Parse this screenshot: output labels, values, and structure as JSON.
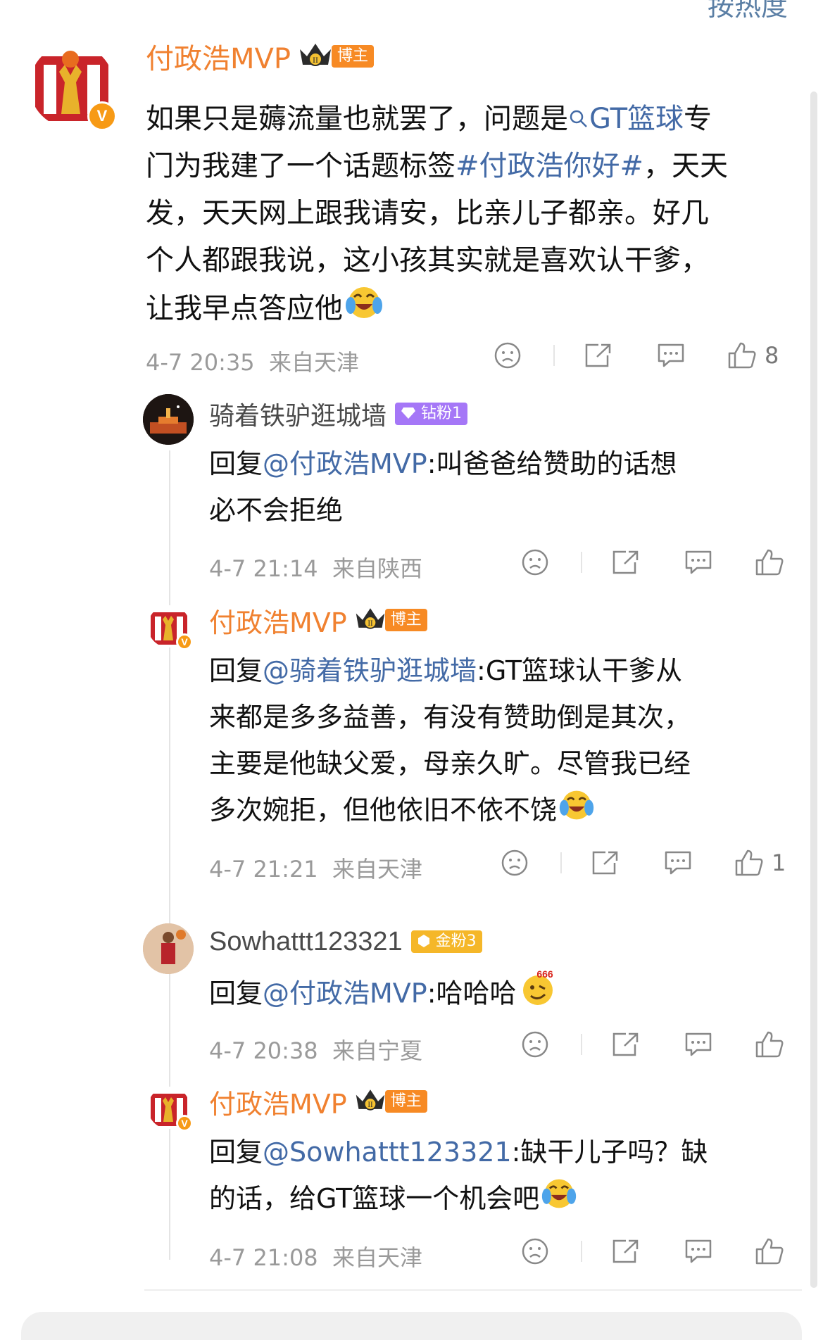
{
  "sort_label": "按热度",
  "main_comment": {
    "author": "付政浩MVP",
    "tag": "博主",
    "line1_text": "如果只是薅流量也就罢了，问题是",
    "line1_link": "GT篮球",
    "line1_tail": "专",
    "line2_a": "门为我建了一个话题标签",
    "line2_link": "#付政浩你好#",
    "line2_b": "，天天",
    "line3": "发，天天网上跟我请安，比亲儿子都亲。好几",
    "line4": "个人都跟我说，这小孩其实就是喜欢认干爹，",
    "line5": "让我早点答应他",
    "time": "4-7 20:35",
    "location": "来自天津",
    "likes": "8"
  },
  "replies": [
    {
      "author": "骑着铁驴逛城墙",
      "tag": "钻粉1",
      "prefix": "回复",
      "mention": "@付政浩MVP",
      "line1": ":叫爸爸给赞助的话想",
      "line2": "必不会拒绝",
      "time": "4-7 21:14",
      "location": "来自陕西"
    },
    {
      "author": "付政浩MVP",
      "tag": "博主",
      "prefix": "回复",
      "mention": "@骑着铁驴逛城墙",
      "line1": ":GT篮球认干爹从",
      "line2": "来都是多多益善，有没有赞助倒是其次，",
      "line3": "主要是他缺父爱，母亲久旷。尽管我已经",
      "line4": "多次婉拒，但他依旧不依不饶",
      "time": "4-7 21:21",
      "location": "来自天津",
      "likes": "1"
    },
    {
      "author": "Sowhattt123321",
      "tag": "金粉3",
      "prefix": "回复",
      "mention": "@付政浩MVP",
      "line1": ":哈哈哈",
      "emoji_text": "666",
      "time": "4-7 20:38",
      "location": "来自宁夏"
    },
    {
      "author": "付政浩MVP",
      "tag": "博主",
      "prefix": "回复",
      "mention": "@Sowhattt123321",
      "line1": ":缺干儿子吗？缺",
      "line2": "的话，给GT篮球一个机会吧",
      "time": "4-7 21:08",
      "location": "来自天津"
    }
  ],
  "crown_level": "II",
  "avatar_badge": "V",
  "colors": {
    "author_orange": "#f08130",
    "link_blue": "#436aa6",
    "meta_gray": "#9a9a9a",
    "tag_blog": "#f78a24",
    "tag_diamond": "#a577f7",
    "tag_gold": "#f5b729"
  },
  "icons": [
    "sad-face-icon",
    "share-icon",
    "comment-icon",
    "thumbs-up-icon",
    "search-icon",
    "laughing-crying-emoji",
    "crown-icon",
    "diamond-icon"
  ]
}
